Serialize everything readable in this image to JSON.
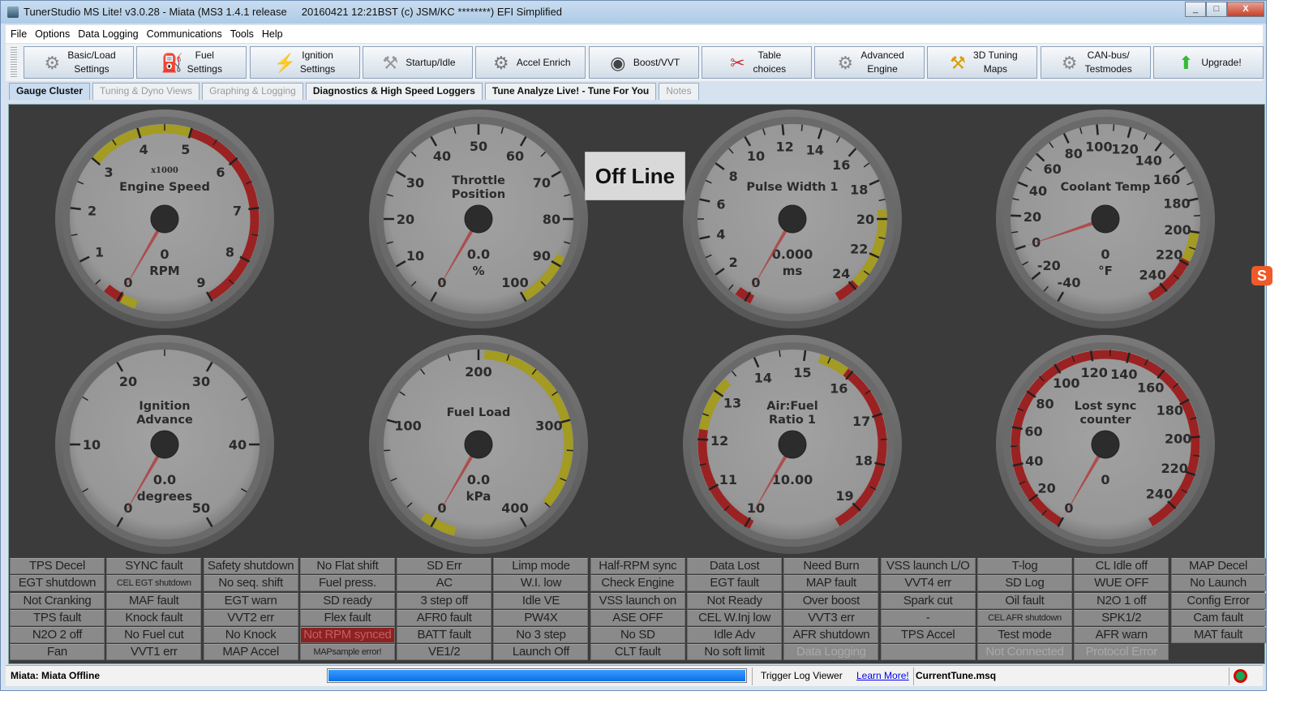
{
  "window": {
    "title": "TunerStudio MS Lite! v3.0.28 - Miata (MS3 1.4.1 release     20160421 12:21BST (c) JSM/KC ********) EFI Simplified",
    "minimize": "_",
    "maximize": "□",
    "close": "X"
  },
  "menu": [
    "File",
    "Options",
    "Data Logging",
    "Communications",
    "Tools",
    "Help"
  ],
  "toolbar": [
    {
      "label": "Basic/Load\nSettings",
      "icon": "gear-icon",
      "glyph": "⚙"
    },
    {
      "label": "Fuel\nSettings",
      "icon": "fuel-injector-icon",
      "glyph": "⛽"
    },
    {
      "label": "Ignition\nSettings",
      "icon": "spark-plug-icon",
      "glyph": "⚡"
    },
    {
      "label": "Startup/Idle",
      "icon": "wrench-icon",
      "glyph": "⚒"
    },
    {
      "label": "Accel Enrich",
      "icon": "tools-icon",
      "glyph": "⚙"
    },
    {
      "label": "Boost/VVT",
      "icon": "turbo-icon",
      "glyph": "◉"
    },
    {
      "label": "Table\nchoices",
      "icon": "wrench-screwdriver-icon",
      "glyph": "✂"
    },
    {
      "label": "Advanced\nEngine",
      "icon": "gears-icon",
      "glyph": "⚙"
    },
    {
      "label": "3D Tuning\nMaps",
      "icon": "hammer-icon",
      "glyph": "⚒"
    },
    {
      "label": "CAN-bus/\nTestmodes",
      "icon": "gear-icon",
      "glyph": "⚙"
    },
    {
      "label": "Upgrade!",
      "icon": "upgrade-arrow-icon",
      "glyph": "⬆"
    }
  ],
  "tabs": [
    {
      "label": "Gauge Cluster",
      "state": "sel"
    },
    {
      "label": "Tuning & Dyno Views",
      "state": "dis"
    },
    {
      "label": "Graphing & Logging",
      "state": "dis"
    },
    {
      "label": "Diagnostics & High Speed Loggers",
      "state": ""
    },
    {
      "label": "Tune Analyze Live! - Tune For You",
      "state": ""
    },
    {
      "label": "Notes",
      "state": "dis"
    }
  ],
  "offline_label": "Off Line",
  "colors": {
    "yellow": "#a39b22",
    "red": "#9b2222",
    "needle": "#b03a3a",
    "progress": "#0a6fe8"
  },
  "gauges": [
    {
      "title": [
        "Engine Speed"
      ],
      "multiplier": "x1000",
      "value": "0",
      "units": "RPM",
      "min": 0,
      "max": 9,
      "labels": [
        "0",
        "1",
        "2",
        "3",
        "4",
        "5",
        "6",
        "7",
        "8",
        "9"
      ],
      "minor": 2,
      "needle": 0,
      "zones": [
        {
          "from": -0.35,
          "to": -0.05,
          "color": "yellow"
        },
        {
          "from": -0.05,
          "to": 0.3,
          "color": "red"
        },
        {
          "from": 3,
          "to": 5,
          "color": "yellow"
        },
        {
          "from": 5,
          "to": 9,
          "color": "red"
        }
      ]
    },
    {
      "title": [
        "Throttle",
        "Position"
      ],
      "multiplier": "",
      "value": "0.0",
      "units": "%",
      "min": 0,
      "max": 100,
      "labels": [
        "0",
        "10",
        "20",
        "30",
        "40",
        "50",
        "60",
        "70",
        "80",
        "90",
        "100"
      ],
      "minor": 2,
      "needle": 0,
      "zones": [
        {
          "from": 88,
          "to": 100,
          "color": "yellow"
        }
      ]
    },
    {
      "title": [
        "Pulse Width 1"
      ],
      "multiplier": "",
      "value": "0.000",
      "units": "ms",
      "min": 0,
      "max": 25,
      "labels": [
        "0",
        "2",
        "4",
        "6",
        "8",
        "10",
        "12",
        "14",
        "16",
        "18",
        "20",
        "22",
        "24"
      ],
      "minor": 2,
      "needle": 0,
      "zones": [
        {
          "from": -0.3,
          "to": 0.6,
          "color": "red"
        },
        {
          "from": 19.5,
          "to": 23.8,
          "color": "yellow"
        },
        {
          "from": 23.8,
          "to": 25,
          "color": "red"
        }
      ]
    },
    {
      "title": [
        "Coolant Temp"
      ],
      "multiplier": "",
      "value": "0",
      "units": "°F",
      "min": -40,
      "max": 250,
      "labels": [
        "-40",
        "-20",
        "0",
        "20",
        "40",
        "60",
        "80",
        "100",
        "120",
        "140",
        "160",
        "180",
        "200",
        "220",
        "240"
      ],
      "minor": 2,
      "needle": 0,
      "zones": [
        {
          "from": 200,
          "to": 218,
          "color": "yellow"
        },
        {
          "from": 218,
          "to": 250,
          "color": "red"
        }
      ]
    },
    {
      "title": [
        "Ignition",
        "Advance"
      ],
      "multiplier": "",
      "value": "0.0",
      "units": "degrees",
      "min": 0,
      "max": 50,
      "labels": [
        "0",
        "10",
        "20",
        "30",
        "40",
        "50"
      ],
      "minor": 2,
      "needle": 0,
      "zones": []
    },
    {
      "title": [
        "Fuel Load"
      ],
      "multiplier": "",
      "value": "0.0",
      "units": "kPa",
      "min": 0,
      "max": 400,
      "labels": [
        "0",
        "100",
        "200",
        "300",
        "400"
      ],
      "minor": 4,
      "needle": 0,
      "zones": [
        {
          "from": -20,
          "to": 10,
          "color": "yellow"
        },
        {
          "from": 205,
          "to": 375,
          "color": "yellow"
        }
      ]
    },
    {
      "title": [
        "Air:Fuel",
        "Ratio 1"
      ],
      "multiplier": "",
      "value": "10.00",
      "units": "",
      "min": 10,
      "max": 19.5,
      "labels": [
        "10",
        "11",
        "12",
        "13",
        "14",
        "15",
        "16",
        "17",
        "18",
        "19"
      ],
      "minor": 2,
      "needle": 10,
      "zones": [
        {
          "from": 9.9,
          "to": 12.2,
          "color": "red"
        },
        {
          "from": 12.2,
          "to": 13.3,
          "color": "yellow"
        },
        {
          "from": 15.3,
          "to": 15.9,
          "color": "yellow"
        },
        {
          "from": 15.9,
          "to": 19.5,
          "color": "red"
        }
      ]
    },
    {
      "title": [
        "Lost sync",
        "counter"
      ],
      "multiplier": "",
      "value": "0",
      "units": "",
      "min": 0,
      "max": 255,
      "labels": [
        "0",
        "20",
        "40",
        "60",
        "80",
        "100",
        "120",
        "140",
        "160",
        "180",
        "200",
        "220",
        "240"
      ],
      "minor": 2,
      "needle": 0,
      "zones": [
        {
          "from": 0,
          "to": 255,
          "color": "red"
        }
      ]
    }
  ],
  "indicators": {
    "rows": [
      [
        "TPS Decel",
        "SYNC fault",
        "Safety shutdown",
        "No Flat shift",
        "SD Err",
        "Limp mode",
        "Half-RPM sync",
        "Data Lost",
        "Need Burn",
        "VSS launch L/O",
        "T-log",
        "CL Idle off",
        "MAP Decel"
      ],
      [
        "EGT shutdown",
        "CEL EGT shutdown",
        "No seq. shift",
        "Fuel press.",
        "AC",
        "W.I. low",
        "Check Engine",
        "EGT fault",
        "MAP fault",
        "VVT4 err",
        "SD Log",
        "WUE OFF",
        "No Launch"
      ],
      [
        "Not Cranking",
        "MAF fault",
        "EGT warn",
        "SD ready",
        "3 step off",
        "Idle VE",
        "VSS launch on",
        "Not Ready",
        "Over boost",
        "Spark cut",
        "Oil fault",
        "N2O 1 off",
        "Config Error"
      ],
      [
        "TPS fault",
        "Knock fault",
        "VVT2 err",
        "Flex fault",
        "AFR0 fault",
        "PW4X",
        "ASE OFF",
        "CEL W.Inj low",
        "VVT3 err",
        "-",
        "CEL AFR shutdown",
        "SPK1/2",
        "Cam fault"
      ],
      [
        "N2O 2 off",
        "No Fuel cut",
        "No Knock",
        "Not RPM synced",
        "BATT fault",
        "No 3 step",
        "No SD",
        "Idle Adv",
        "AFR shutdown",
        "TPS Accel",
        "Test mode",
        "AFR warn",
        "MAT fault"
      ],
      [
        "Fan",
        "VVT1 err",
        "MAP Accel",
        "MAPsample error!",
        "VE1/2",
        "Launch Off",
        "CLT fault",
        "No soft limit",
        "Data Logging",
        "",
        "Not Connected",
        "Protocol Error",
        null
      ]
    ],
    "alert": [
      "Not RPM synced"
    ],
    "inactive": [
      "Data Logging",
      "Not Connected",
      "Protocol Error"
    ],
    "small": [
      "CEL EGT shutdown",
      "CEL AFR shutdown",
      "MAPsample error!"
    ]
  },
  "status": {
    "connection": "Miata: Miata Offline",
    "progress": 1.0,
    "trigger_log": "Trigger Log Viewer",
    "learn_more": "Learn More!",
    "tune_file": "CurrentTune.msq"
  },
  "ime_icon": "S"
}
